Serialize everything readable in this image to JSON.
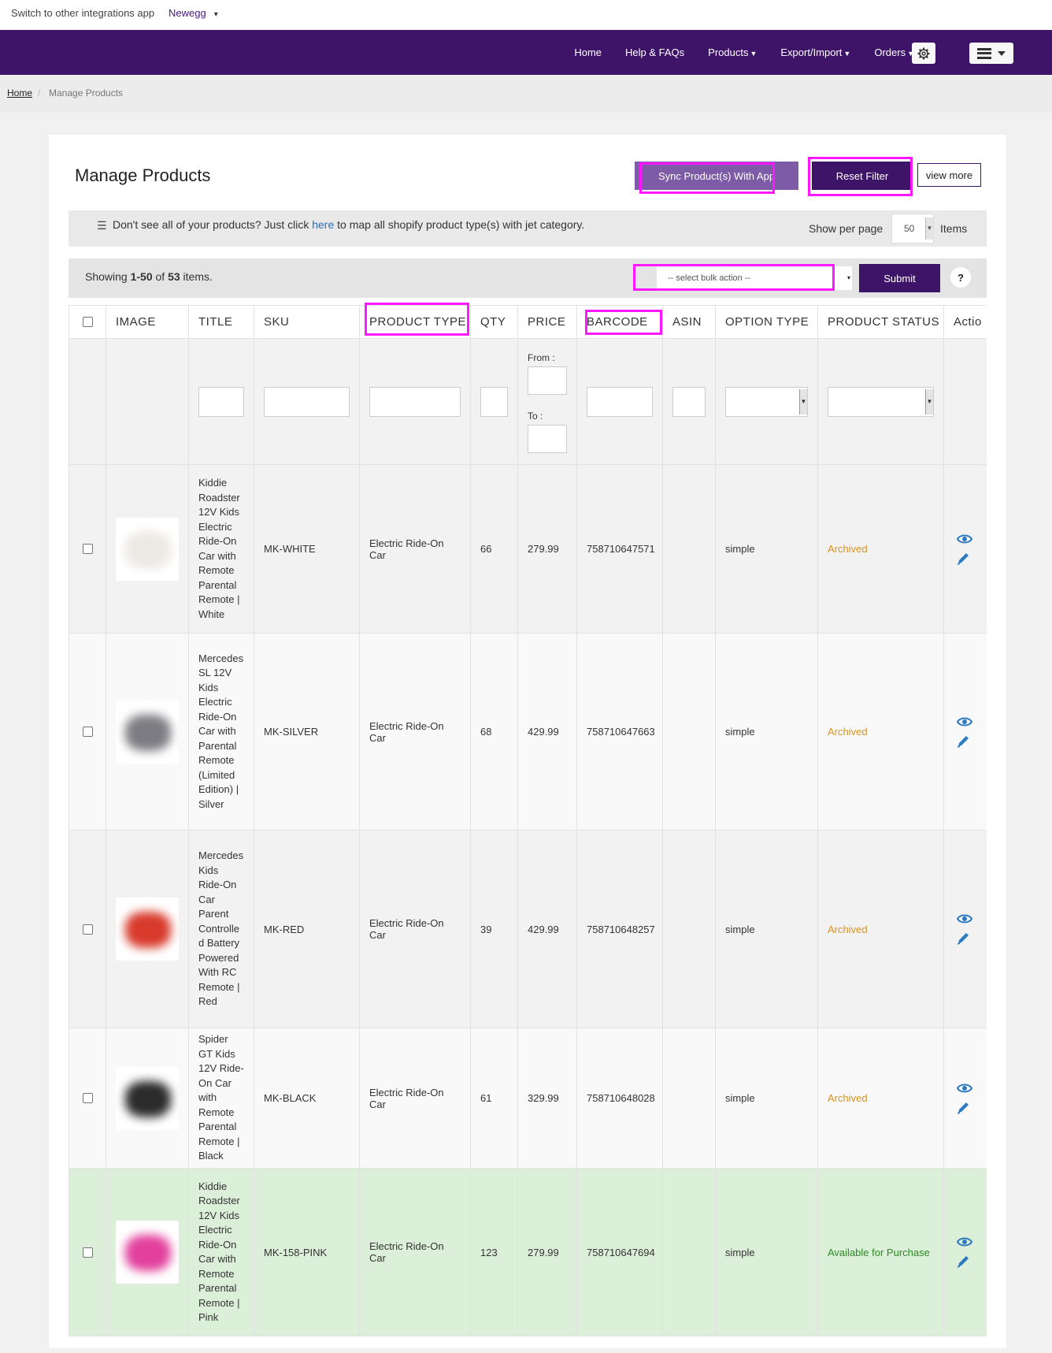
{
  "switcher": {
    "label": "Switch to other integrations app",
    "selected": "Newegg"
  },
  "nav": {
    "items": [
      {
        "label": "Home",
        "caret": false
      },
      {
        "label": "Help & FAQs",
        "caret": false
      },
      {
        "label": "Products",
        "caret": true
      },
      {
        "label": "Export/Import",
        "caret": true
      },
      {
        "label": "Orders",
        "caret": true
      }
    ],
    "settings_icon": "gear-icon",
    "menu_icon": "hamburger-icon"
  },
  "breadcrumb": {
    "home": "Home",
    "current": "Manage Products"
  },
  "page": {
    "title": "Manage Products",
    "sync_button": "Sync Product(s) With App",
    "reset_button": "Reset Filter",
    "view_more_button": "view more"
  },
  "info": {
    "msg_before": "Don't see all of your products? Just click ",
    "link": "here",
    "msg_after": " to map all shopify product type(s) with jet category.",
    "per_page_label": "Show per page",
    "per_page_value": "50",
    "items_label": "Items"
  },
  "summary": {
    "prefix": "Showing ",
    "range": "1-50",
    "of": " of ",
    "total": "53",
    "suffix": " items.",
    "bulk_placeholder": "-- select bulk action --",
    "submit": "Submit",
    "help": "?"
  },
  "table": {
    "columns": [
      "IMAGE",
      "TITLE",
      "SKU",
      "PRODUCT TYPE",
      "QTY",
      "PRICE",
      "BARCODE",
      "ASIN",
      "OPTION TYPE",
      "PRODUCT STATUS",
      "Actio"
    ],
    "price_from": "From :",
    "price_to": "To :",
    "rows": [
      {
        "title": "Kiddie Roadster 12V Kids Electric Ride-On Car with Remote Parental Remote | White",
        "sku": "MK-WHITE",
        "type": "Electric Ride-On Car",
        "qty": "66",
        "price": "279.99",
        "barcode": "758710647571",
        "asin": "",
        "option": "simple",
        "status": "Archived",
        "status_kind": "archived",
        "image_color": "#ece8e3"
      },
      {
        "title": "Mercedes SL 12V Kids Electric Ride-On Car with Parental Remote (Limited Edition) | Silver",
        "sku": "MK-SILVER",
        "type": "Electric Ride-On Car",
        "qty": "68",
        "price": "429.99",
        "barcode": "758710647663",
        "asin": "",
        "option": "simple",
        "status": "Archived",
        "status_kind": "archived",
        "image_color": "#7c7c82"
      },
      {
        "title": "Mercedes Kids Ride-On Car Parent Controlled Battery Powered With RC Remote | Red",
        "sku": "MK-RED",
        "type": "Electric Ride-On Car",
        "qty": "39",
        "price": "429.99",
        "barcode": "758710648257",
        "asin": "",
        "option": "simple",
        "status": "Archived",
        "status_kind": "archived",
        "image_color": "#d83a2c"
      },
      {
        "title": "Spider GT Kids 12V Ride-On Car with Remote Parental Remote | Black",
        "sku": "MK-BLACK",
        "type": "Electric Ride-On Car",
        "qty": "61",
        "price": "329.99",
        "barcode": "758710648028",
        "asin": "",
        "option": "simple",
        "status": "Archived",
        "status_kind": "archived",
        "image_color": "#2b2b2b"
      },
      {
        "title": "Kiddie Roadster 12V Kids Electric Ride-On Car with Remote Parental Remote | Pink",
        "sku": "MK-158-PINK",
        "type": "Electric Ride-On Car",
        "qty": "123",
        "price": "279.99",
        "barcode": "758710647694",
        "asin": "",
        "option": "simple",
        "status": "Available for Purchase",
        "status_kind": "available",
        "image_color": "#e2409c"
      }
    ]
  },
  "colors": {
    "primary": "#3e1468",
    "sync": "#7d5ba6",
    "highlight": "#ff17ff",
    "archived": "#d9921e",
    "available": "#2c8a23",
    "green_row": "#dcefd8"
  }
}
